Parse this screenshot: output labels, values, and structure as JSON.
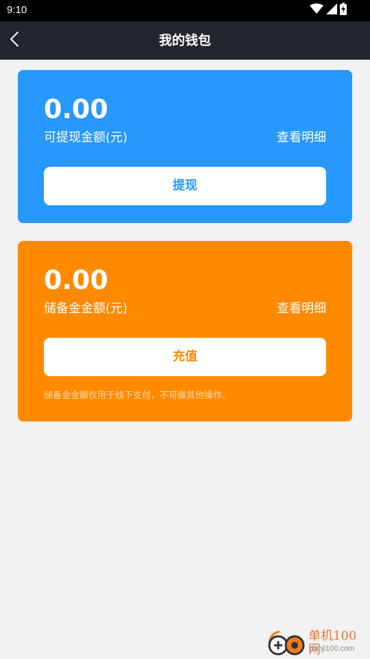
{
  "status_bar": {
    "time": "9:10",
    "icons": [
      "wifi-icon",
      "signal-icon",
      "battery-icon"
    ]
  },
  "nav": {
    "title": "我的钱包",
    "back_icon": "chevron-left-icon"
  },
  "withdraw_card": {
    "amount": "0.00",
    "label": "可提现金额(元)",
    "detail_link": "查看明细",
    "button_label": "提现",
    "color": "#2798fd"
  },
  "reserve_card": {
    "amount": "0.00",
    "label": "储备金金额(元)",
    "detail_link": "查看明细",
    "button_label": "充值",
    "note": "储备金金额仅用于线下支付，不可做其他操作。",
    "color": "#ff8a00"
  },
  "watermark": {
    "title": "单机100网",
    "url": "danji100.com"
  }
}
